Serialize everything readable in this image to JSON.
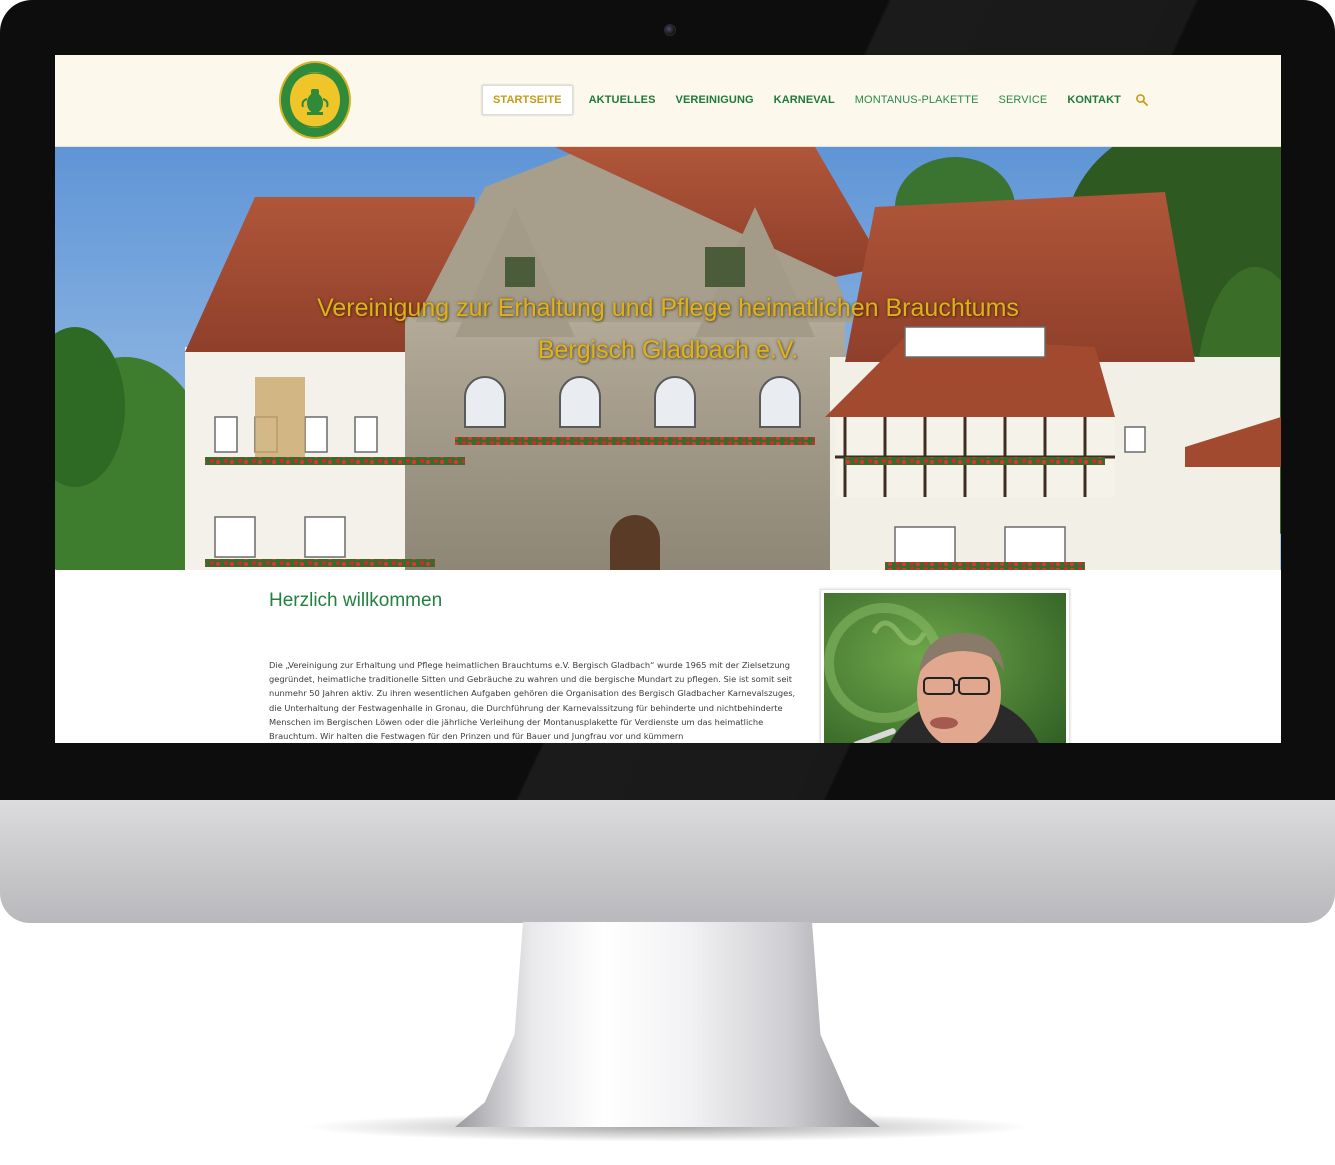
{
  "site": {
    "nav": {
      "items": [
        {
          "label": "STARTSEITE",
          "active": true
        },
        {
          "label": "AKTUELLES",
          "active": false
        },
        {
          "label": "VEREINIGUNG",
          "active": false
        },
        {
          "label": "KARNEVAL",
          "active": false
        },
        {
          "label": "MONTANUS-PLAKETTE",
          "active": false
        },
        {
          "label": "SERVICE",
          "active": false
        },
        {
          "label": "KONTAKT",
          "active": false
        }
      ],
      "search_icon": "search-icon"
    },
    "logo": {
      "icon": "emblem-logo"
    },
    "hero": {
      "title_line1": "Vereinigung zur Erhaltung und Pflege heimatlichen Brauchtums",
      "title_line2": "Bergisch Gladbach e.V."
    },
    "welcome": {
      "heading": "Herzlich willkommen",
      "text": "Die „Vereinigung zur Erhaltung und Pflege heimatlichen Brauchtums e.V. Bergisch Gladbach“ wurde 1965 mit der Zielsetzung gegründet, heimatliche traditionelle Sitten und Gebräuche zu wahren und die bergische Mundart zu pflegen. Sie ist somit seit nunmehr 50 Jahren aktiv. Zu ihren wesentlichen Aufgaben gehören die Organisation des Bergisch Gladbacher Karnevalszuges, die Unterhaltung der Festwagenhalle in Gronau, die Durchführung der Karnevalssitzung für behinderte und nichtbehinderte Menschen im Bergischen Löwen oder die jährliche Verleihung der Montanusplakette für Verdienste um das heimatliche Brauchtum. Wir halten die Festwagen für den Prinzen und für Bauer und Jungfrau vor und kümmern"
    }
  },
  "colors": {
    "nav_green": "#1e7a3c",
    "active_gold": "#c99a17",
    "header_bg": "#fcf8ec",
    "heading_green": "#23813f",
    "hero_title_gold": "#e0b21a"
  }
}
